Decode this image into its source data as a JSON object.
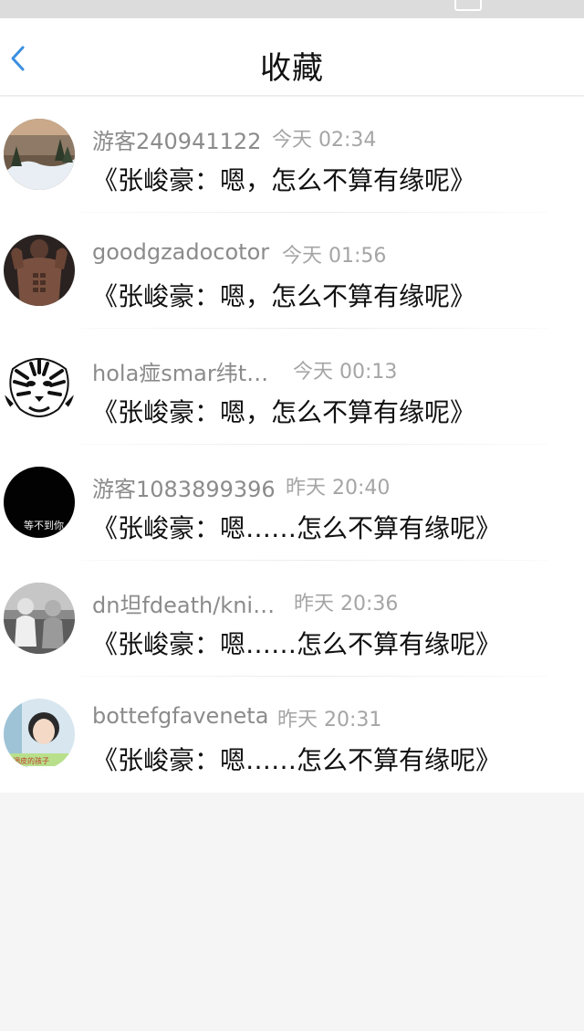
{
  "header": {
    "title": "收藏"
  },
  "favorites": [
    {
      "username": "游客240941122",
      "time": "今天 02:34",
      "message": "《张峻豪：嗯，怎么不算有缘呢》"
    },
    {
      "username": "goodgzadocotor",
      "time": "今天 01:56",
      "message": "《张峻豪：嗯，怎么不算有缘呢》"
    },
    {
      "username": "hola痖smar纬t…",
      "time": "今天 00:13",
      "message": "《张峻豪：嗯，怎么不算有缘呢》"
    },
    {
      "username": "游客1083899396",
      "time": "昨天 20:40",
      "message": "《张峻豪：嗯……怎么不算有缘呢》",
      "avatar_text": "等不到你"
    },
    {
      "username": "dn坦fdeath/kni…",
      "time": "昨天 20:36",
      "message": "《张峻豪：嗯……怎么不算有缘呢》"
    },
    {
      "username": "bottefgfaveneta",
      "time": "昨天 20:31",
      "message": "《张峻豪：嗯……怎么不算有缘呢》",
      "avatar_text": "小调皮的孩子"
    }
  ]
}
